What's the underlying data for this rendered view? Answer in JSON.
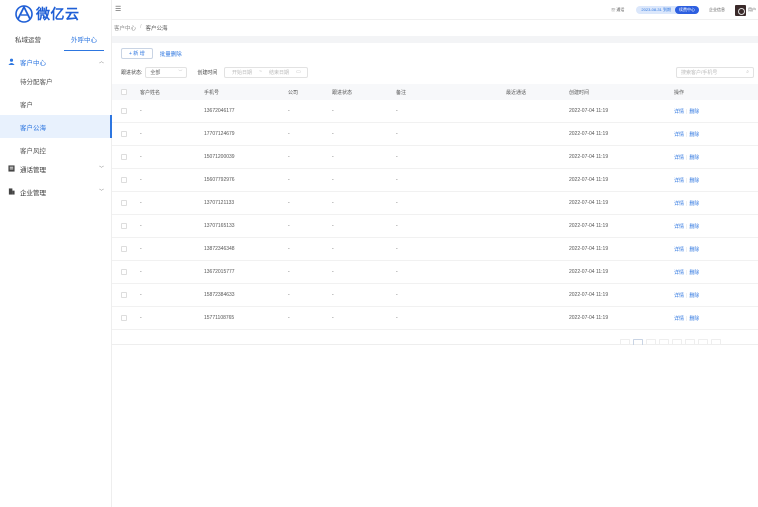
{
  "app": {
    "logo_text": "微亿云",
    "top_tabs": [
      {
        "label": "私域运营",
        "active": false
      },
      {
        "label": "外呼中心",
        "active": true
      }
    ]
  },
  "sidebar": {
    "groups": [
      {
        "label": "客户中心",
        "icon": "user-icon",
        "open": true,
        "items": [
          {
            "label": "待分配客户",
            "active": false
          },
          {
            "label": "客户",
            "active": false
          },
          {
            "label": "客户公海",
            "active": true
          },
          {
            "label": "客户风控",
            "active": false
          }
        ]
      },
      {
        "label": "通话管理",
        "icon": "phone-log-icon",
        "open": false
      },
      {
        "label": "企业管理",
        "icon": "building-icon",
        "open": false
      }
    ]
  },
  "header": {
    "menu_icon": "hamburger-icon",
    "phone": "☏ 通话",
    "pill_text": "2023-08-31 到期",
    "pill_button": "续费中心",
    "org": "企业信息",
    "user": "用户"
  },
  "breadcrumb": [
    "客户中心",
    "客户公海"
  ],
  "toolbar": {
    "add_label": "+ 新 增",
    "bulk_delete_label": "批量删除"
  },
  "filters": {
    "status_label": "跟进状态:",
    "status_value": "全部",
    "time_label": "创建时间",
    "date_start_placeholder": "开始日期",
    "date_sep": "~",
    "date_end_placeholder": "结束日期",
    "search_placeholder": "搜索客户/手机号"
  },
  "table": {
    "columns": [
      "客户姓名",
      "手机号",
      "公司",
      "跟进状态",
      "备注",
      "最近通话",
      "创建时间",
      "操作"
    ],
    "rows": [
      {
        "name": "-",
        "phone": "13672046177",
        "company": "-",
        "status": "-",
        "note": "-",
        "last_call": "",
        "created": "2022-07-04 11:19"
      },
      {
        "name": "-",
        "phone": "17707124679",
        "company": "-",
        "status": "-",
        "note": "-",
        "last_call": "",
        "created": "2022-07-04 11:19"
      },
      {
        "name": "-",
        "phone": "15071200039",
        "company": "-",
        "status": "-",
        "note": "-",
        "last_call": "",
        "created": "2022-07-04 11:19"
      },
      {
        "name": "-",
        "phone": "15607792976",
        "company": "-",
        "status": "-",
        "note": "-",
        "last_call": "",
        "created": "2022-07-04 11:19"
      },
      {
        "name": "-",
        "phone": "13707121133",
        "company": "-",
        "status": "-",
        "note": "-",
        "last_call": "",
        "created": "2022-07-04 11:19"
      },
      {
        "name": "-",
        "phone": "13707165133",
        "company": "-",
        "status": "-",
        "note": "-",
        "last_call": "",
        "created": "2022-07-04 11:19"
      },
      {
        "name": "-",
        "phone": "13872346348",
        "company": "-",
        "status": "-",
        "note": "-",
        "last_call": "",
        "created": "2022-07-04 11:19"
      },
      {
        "name": "-",
        "phone": "13672015777",
        "company": "-",
        "status": "-",
        "note": "-",
        "last_call": "",
        "created": "2022-07-04 11:19"
      },
      {
        "name": "-",
        "phone": "15872384633",
        "company": "-",
        "status": "-",
        "note": "-",
        "last_call": "",
        "created": "2022-07-04 11:19"
      },
      {
        "name": "-",
        "phone": "15771108765",
        "company": "-",
        "status": "-",
        "note": "-",
        "last_call": "",
        "created": "2022-07-04 11:19"
      }
    ],
    "op_detail": "详情",
    "op_delete": "删除"
  },
  "colors": {
    "accent": "#2d76e0",
    "active_bg": "#e8f1fd",
    "logo": "#1f5fd6"
  }
}
